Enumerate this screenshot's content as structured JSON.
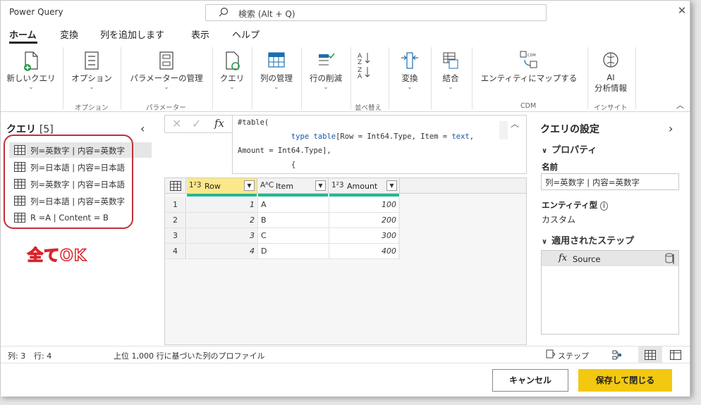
{
  "app": {
    "title": "Power Query"
  },
  "search": {
    "placeholder": "検索 (Alt + Q)"
  },
  "menu": {
    "items": [
      "ホーム",
      "変換",
      "列を追加します",
      "表示",
      "ヘルプ"
    ]
  },
  "ribbon": {
    "buttons": {
      "new_query": "新しいクエリ",
      "options": "オプション",
      "manage_params": "パラメーターの管理",
      "query": "クエリ",
      "manage_cols": "列の管理",
      "reduce_rows": "行の削減",
      "transform": "変換",
      "combine": "結合",
      "map_entity": "エンティティにマップする",
      "ai_line1": "AI",
      "ai_line2": "分析情報"
    },
    "groups": {
      "options": "オプション",
      "parameters": "パラメーター",
      "sort": "並べ替え",
      "cdm": "CDM",
      "insight": "インサイト"
    },
    "cdm_badge": "CDM"
  },
  "queries": {
    "title": "クエリ",
    "count": "[5]",
    "items": [
      "列=英数字 | 内容=英数字",
      "列=日本語 | 内容=日本語",
      "列=英数字 | 内容=日本語",
      "列=日本語 | 内容=英数字",
      "R =A | Content = B"
    ]
  },
  "annotation": "全てOK",
  "formula": {
    "line1": "#table(",
    "line2_indent": "            ",
    "line2_kw": "type",
    "line2_sp": " ",
    "line2_kw2": "table",
    "line2_rest": "[Row = Int64.Type, Item = ",
    "line2_kw3": "text",
    "line2_end": ",",
    "line3": "Amount = Int64.Type],",
    "line4": "            {"
  },
  "grid": {
    "columns": [
      {
        "type": "1²3",
        "name": "Row"
      },
      {
        "type": "AᴬC",
        "name": "Item"
      },
      {
        "type": "1²3",
        "name": "Amount"
      }
    ],
    "rows": [
      {
        "n": "1",
        "row": "1",
        "item": "A",
        "amount": "100"
      },
      {
        "n": "2",
        "row": "2",
        "item": "B",
        "amount": "200"
      },
      {
        "n": "3",
        "row": "3",
        "item": "C",
        "amount": "300"
      },
      {
        "n": "4",
        "row": "4",
        "item": "D",
        "amount": "400"
      }
    ]
  },
  "settings": {
    "title": "クエリの設定",
    "properties": "プロパティ",
    "name_label": "名前",
    "name_value": "列=英数字 | 内容=英数字",
    "entity_label": "エンティティ型",
    "entity_value": "カスタム",
    "steps_label": "適用されたステップ",
    "steps": [
      "Source"
    ]
  },
  "status": {
    "cols": "列: 3",
    "rows": "行: 4",
    "profile": "上位 1,000 行に基づいた列のプロファイル",
    "step": "ステップ"
  },
  "footer": {
    "cancel": "キャンセル",
    "ok": "保存して閉じる"
  },
  "colors": {
    "accent": "#f2c811",
    "quality": "#25b892",
    "annotation": "#d7252d"
  }
}
